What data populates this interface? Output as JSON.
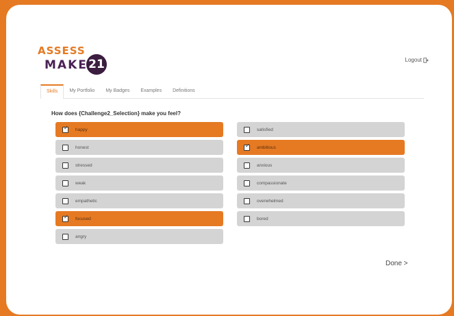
{
  "brand": {
    "assess": "ASSESS",
    "make": "MAKE",
    "badge": "21",
    "accent": "#e57a23",
    "dark": "#3b1d3f"
  },
  "header": {
    "logout_label": "Logout",
    "logout_icon": "logout-icon"
  },
  "tabs": [
    {
      "label": "Skills",
      "active": true
    },
    {
      "label": "My Portfolio",
      "active": false
    },
    {
      "label": "My Badges",
      "active": false
    },
    {
      "label": "Examples",
      "active": false
    },
    {
      "label": "Definitions",
      "active": false
    }
  ],
  "question": "How does {Challenge2_Selection} make you feel?",
  "options_left": [
    {
      "label": "happy",
      "checked": true
    },
    {
      "label": "honest",
      "checked": false
    },
    {
      "label": "stressed",
      "checked": false
    },
    {
      "label": "weak",
      "checked": false
    },
    {
      "label": "empathetic",
      "checked": false
    },
    {
      "label": "focused",
      "checked": true
    },
    {
      "label": "angry",
      "checked": false
    }
  ],
  "options_right": [
    {
      "label": "satisfied",
      "checked": false
    },
    {
      "label": "ambitious",
      "checked": true
    },
    {
      "label": "anxious",
      "checked": false
    },
    {
      "label": "compassionate",
      "checked": false
    },
    {
      "label": "overwhelmed",
      "checked": false
    },
    {
      "label": "bored",
      "checked": false
    }
  ],
  "done_label": "Done >"
}
